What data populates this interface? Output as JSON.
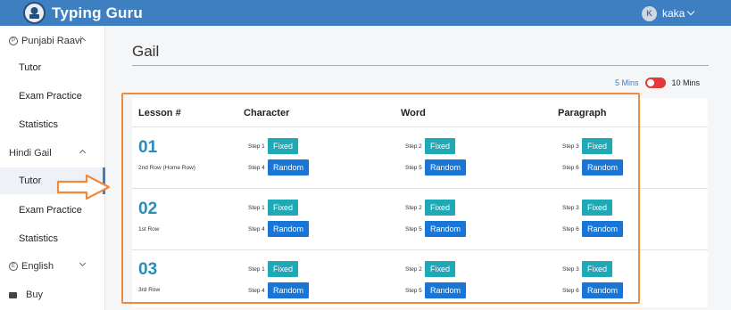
{
  "app": {
    "brand": "Typing Guru",
    "user_initial": "K",
    "user_name": "kaka"
  },
  "sidebar": {
    "groups": [
      {
        "icon": "P",
        "label": "Punjabi Raavi",
        "items": [
          "Tutor",
          "Exam Practice",
          "Statistics"
        ]
      },
      {
        "label": "Hindi Gail",
        "items": [
          "Tutor",
          "Exam Practice",
          "Statistics"
        ]
      },
      {
        "icon": "E",
        "label": "English"
      },
      {
        "label": "Buy"
      }
    ]
  },
  "main": {
    "title": "Gail",
    "toggle": {
      "left_label": "5 Mins",
      "right_label": "10 Mins",
      "state": "10 Mins"
    },
    "columns": [
      "Lesson #",
      "Character",
      "Word",
      "Paragraph"
    ],
    "lessons": [
      {
        "number": "01",
        "description": "2nd Row (Home Row)",
        "cells": [
          {
            "fixed_step": "Step 1",
            "fixed_label": "Fixed",
            "random_step": "Step 4",
            "random_label": "Random"
          },
          {
            "fixed_step": "Step 2",
            "fixed_label": "Fixed",
            "random_step": "Step 5",
            "random_label": "Random"
          },
          {
            "fixed_step": "Step 3",
            "fixed_label": "Fixed",
            "random_step": "Step 6",
            "random_label": "Random"
          }
        ]
      },
      {
        "number": "02",
        "description": "1st Row",
        "cells": [
          {
            "fixed_step": "Step 1",
            "fixed_label": "Fixed",
            "random_step": "Step 4",
            "random_label": "Random"
          },
          {
            "fixed_step": "Step 2",
            "fixed_label": "Fixed",
            "random_step": "Step 5",
            "random_label": "Random"
          },
          {
            "fixed_step": "Step 3",
            "fixed_label": "Fixed",
            "random_step": "Step 6",
            "random_label": "Random"
          }
        ]
      },
      {
        "number": "03",
        "description": "3rd Row",
        "cells": [
          {
            "fixed_step": "Step 1",
            "fixed_label": "Fixed",
            "random_step": "Step 4",
            "random_label": "Random"
          },
          {
            "fixed_step": "Step 2",
            "fixed_label": "Fixed",
            "random_step": "Step 5",
            "random_label": "Random"
          },
          {
            "fixed_step": "Step 3",
            "fixed_label": "Fixed",
            "random_step": "Step 6",
            "random_label": "Random"
          }
        ]
      }
    ]
  },
  "colors": {
    "topbar": "#3d7fc0",
    "fixed": "#1fa8b6",
    "random": "#1a76d6",
    "lesson_number": "#2a8cb8",
    "highlight": "#f08a3c",
    "toggle_on": "#e03a3a"
  }
}
